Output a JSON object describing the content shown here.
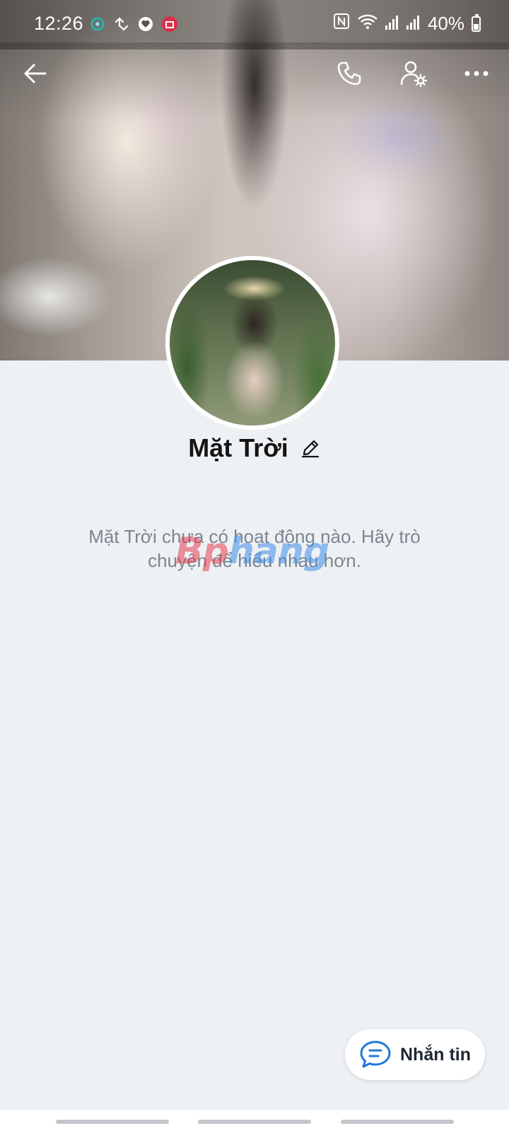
{
  "status_bar": {
    "time": "12:26",
    "battery": "40%"
  },
  "profile": {
    "name": "Mặt Trời",
    "empty_message": "Mặt Trời chưa có hoạt động nào. Hãy trò chuyện để hiểu nhau hơn."
  },
  "watermark": {
    "part1": "Bp",
    "part2": "hang"
  },
  "actions": {
    "message_label": "Nhắn tin"
  },
  "colors": {
    "background": "#eef1f4",
    "accent": "#1f79d6"
  }
}
